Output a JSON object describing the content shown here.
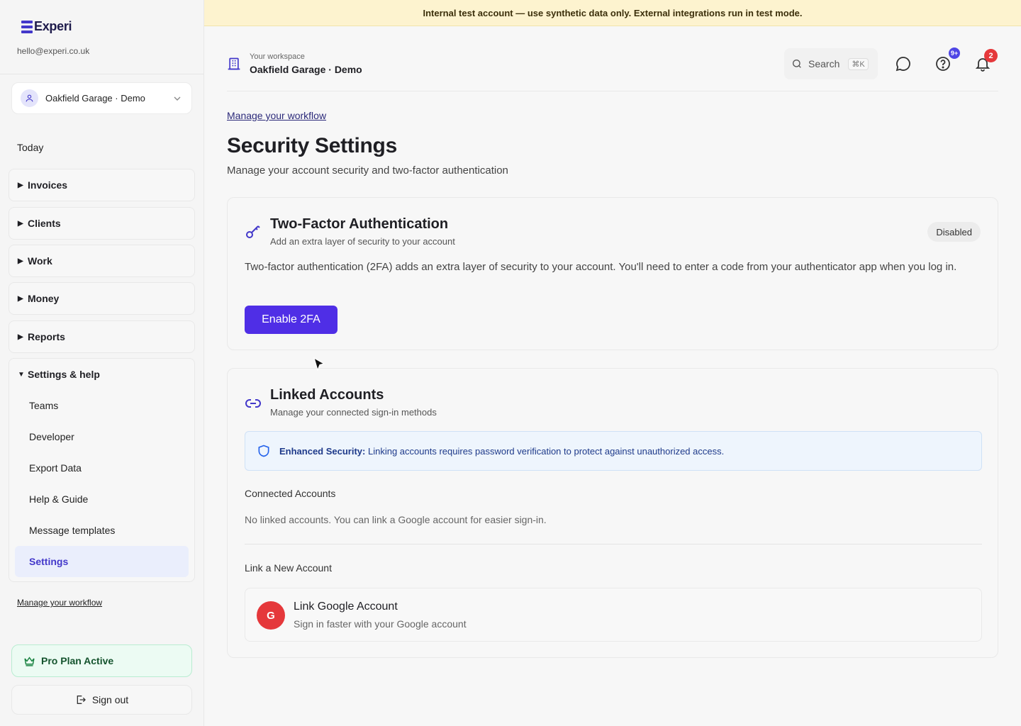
{
  "app": {
    "name": "Experi",
    "email": "hello@experi.co.uk"
  },
  "banner": {
    "text": "Internal test account — use synthetic data only. External integrations run in test mode."
  },
  "workspace_select": {
    "name": "Oakfield Garage · Demo"
  },
  "sidebar": {
    "today": "Today",
    "groups": [
      {
        "label": "Invoices",
        "expanded": false
      },
      {
        "label": "Clients",
        "expanded": false
      },
      {
        "label": "Work",
        "expanded": false
      },
      {
        "label": "Money",
        "expanded": false
      },
      {
        "label": "Reports",
        "expanded": false
      },
      {
        "label": "Settings & help",
        "expanded": true
      }
    ],
    "settings_items": [
      "Teams",
      "Developer",
      "Export Data",
      "Help & Guide",
      "Message templates",
      "Settings"
    ],
    "active_item": "Settings",
    "workflow_link": "Manage your workflow",
    "pro_plan": "Pro Plan Active",
    "sign_out": "Sign out"
  },
  "header": {
    "ws_label": "Your workspace",
    "ws_title": "Oakfield Garage · Demo",
    "search_label": "Search",
    "search_shortcut": "⌘K",
    "help_badge": "9+",
    "notif_badge": "2"
  },
  "main": {
    "breadcrumb": "Manage your workflow",
    "title": "Security Settings",
    "subtitle": "Manage your account security and two-factor authentication",
    "twofa": {
      "title": "Two-Factor Authentication",
      "subtitle": "Add an extra layer of security to your account",
      "status": "Disabled",
      "description": "Two-factor authentication (2FA) adds an extra layer of security to your account. You'll need to enter a code from your authenticator app when you log in.",
      "button": "Enable 2FA"
    },
    "linked": {
      "title": "Linked Accounts",
      "subtitle": "Manage your connected sign-in methods",
      "alert_bold": "Enhanced Security:",
      "alert_text": "Linking accounts requires password verification to protect against unauthorized access.",
      "connected_label": "Connected Accounts",
      "empty_text": "No linked accounts. You can link a Google account for easier sign-in.",
      "link_new_label": "Link a New Account",
      "google_avatar": "G",
      "google_title": "Link Google Account",
      "google_sub": "Sign in faster with your Google account"
    }
  },
  "colors": {
    "accent": "#4f2ee6",
    "brand": "#4338ca",
    "banner": "#fdf3cf",
    "danger_badge": "#e5383b"
  }
}
